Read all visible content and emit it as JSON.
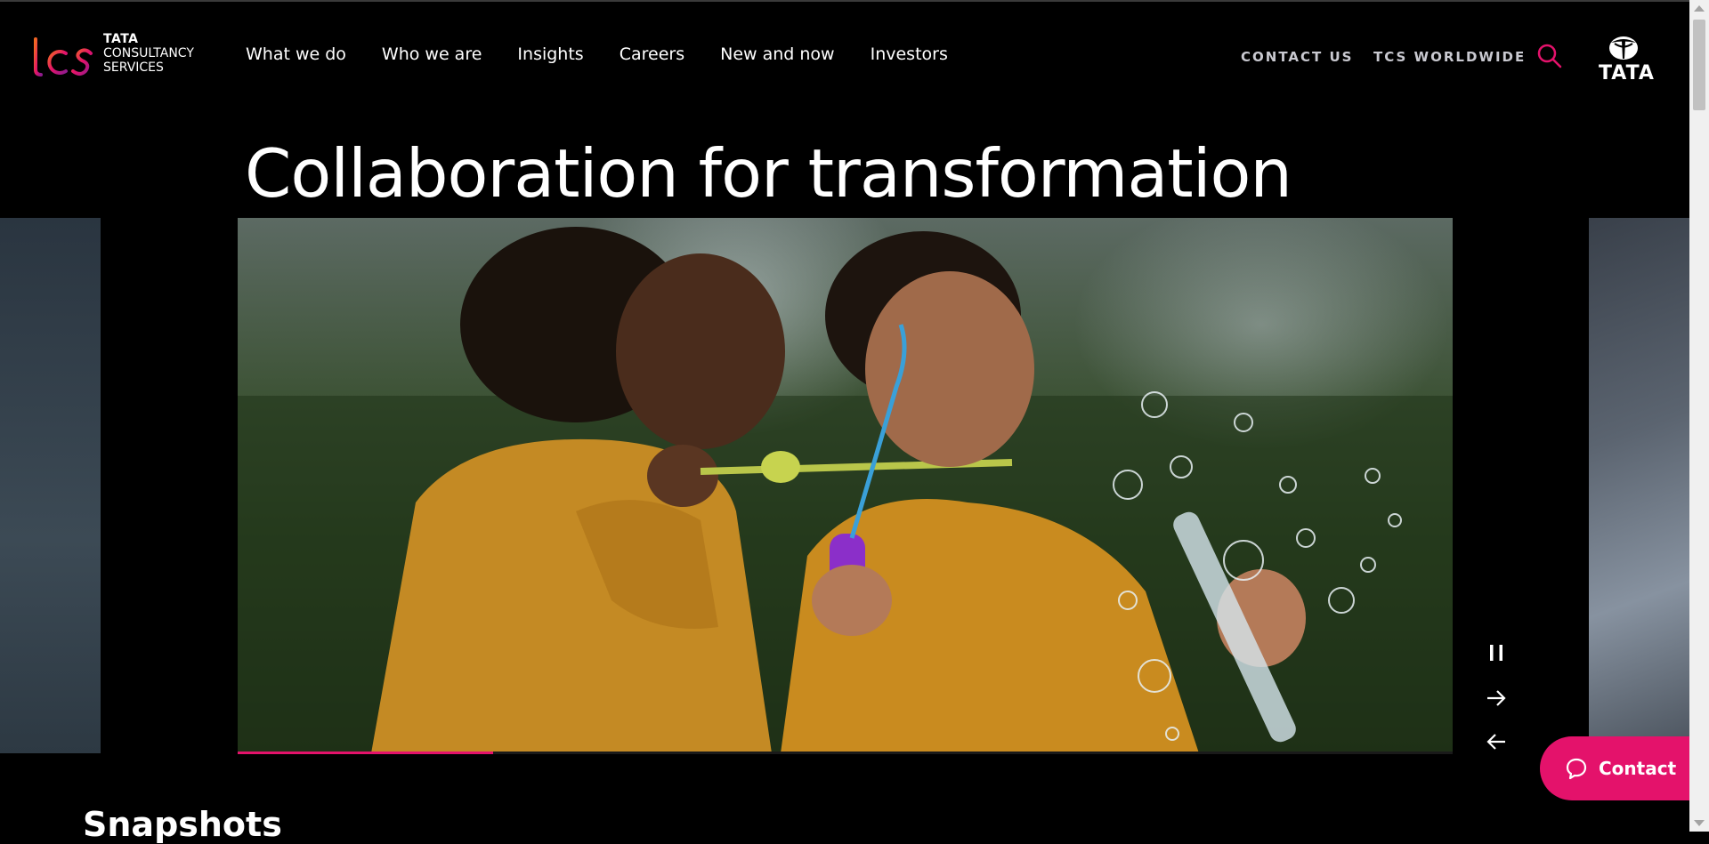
{
  "header": {
    "logo": {
      "wordmark": "tcs",
      "line1": "TATA",
      "line2": "CONSULTANCY",
      "line3": "SERVICES"
    },
    "nav": [
      {
        "label": "What we do"
      },
      {
        "label": "Who we are"
      },
      {
        "label": "Insights"
      },
      {
        "label": "Careers"
      },
      {
        "label": "New and now"
      },
      {
        "label": "Investors"
      }
    ],
    "contact_us": "CONTACT US",
    "worldwide": "TCS WORLDWIDE",
    "search_icon": "search-icon",
    "tata_logo_text": "TATA"
  },
  "hero": {
    "title": "Collaboration for transformation",
    "image_alt_icon": "hero-image",
    "progress": 0.21
  },
  "carousel_controls": {
    "pause_icon": "pause-icon",
    "next_icon": "arrow-right-icon",
    "prev_icon": "arrow-left-icon"
  },
  "contact_button": {
    "label": "Contact",
    "icon": "chat-bubble-icon"
  },
  "next_section": {
    "title": "Snapshots"
  },
  "colors": {
    "accent": "#e4126b",
    "background": "#000000",
    "text": "#ffffff",
    "util_text": "#c9c9d0"
  }
}
